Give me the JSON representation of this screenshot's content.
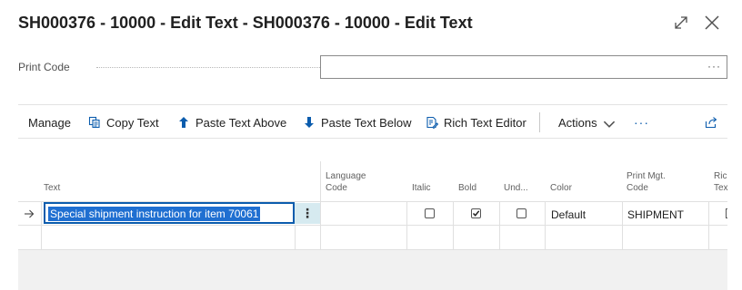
{
  "window": {
    "title": "SH000376 - 10000 - Edit Text - SH000376 - 10000 - Edit Text",
    "expand_icon": "expand-icon",
    "close_icon": "close-icon"
  },
  "print_code": {
    "label": "Print Code",
    "value": "",
    "more": "···"
  },
  "actions": {
    "manage": "Manage",
    "copy_text": "Copy Text",
    "paste_above": "Paste Text Above",
    "paste_below": "Paste Text Below",
    "rich_text_editor": "Rich Text Editor",
    "actions": "Actions",
    "more": "···"
  },
  "colors": {
    "accent": "#0b5cad",
    "selection": "#1f6fd1",
    "row_menu_bg": "#d6eaf0"
  },
  "grid": {
    "headers": {
      "text": "Text",
      "language_code_1": "Language",
      "language_code_2": "Code",
      "italic": "Italic",
      "bold": "Bold",
      "underline": "Und...",
      "color": "Color",
      "print_mgt_1": "Print Mgt.",
      "print_mgt_2": "Code",
      "rich_1": "Ric",
      "rich_2": "Tex"
    },
    "rows": [
      {
        "text": "Special shipment instruction for item 70061",
        "language_code": "",
        "italic": false,
        "bold": true,
        "underline": false,
        "color": "Default",
        "print_mgt_code": "SHIPMENT"
      }
    ]
  }
}
